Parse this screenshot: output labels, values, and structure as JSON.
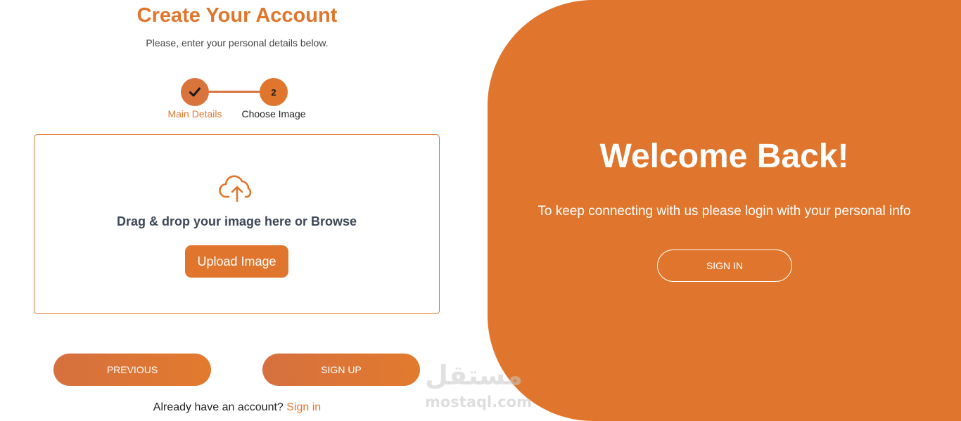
{
  "form": {
    "title": "Create Your Account",
    "subtitle": "Please, enter your personal details below.",
    "steps": [
      {
        "label": "Main Details",
        "status": "completed",
        "icon": "checkmark-icon"
      },
      {
        "label": "Choose Image",
        "number": "2",
        "status": "active"
      }
    ],
    "dropzone": {
      "icon": "cloud-upload-icon",
      "text": "Drag & drop your image here or Browse",
      "button_label": "Upload Image"
    },
    "previous_label": "PREVIOUS",
    "signup_label": "SIGN UP",
    "account_prompt": "Already have an account?",
    "signin_link_label": "Sign in"
  },
  "welcome": {
    "title": "Welcome Back!",
    "text": "To keep connecting with us please login with your personal info",
    "signin_button_label": "SIGN IN"
  },
  "watermark": {
    "arabic": "مستقل",
    "latin": "mostaql.com"
  },
  "colors": {
    "accent": "#e0762d",
    "accent_dark": "#d6703f",
    "text_dark": "#3d4757"
  }
}
